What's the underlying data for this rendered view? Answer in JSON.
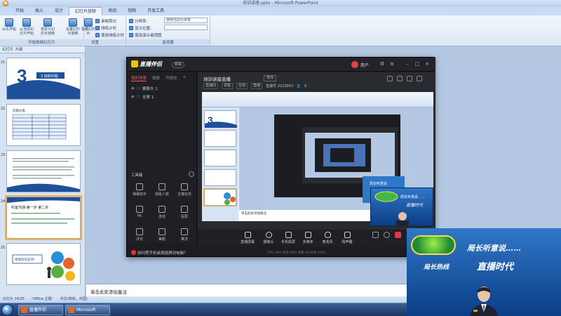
{
  "ppt": {
    "title": "培训讲座.pptx - Microsoft PowerPoint",
    "tabs": [
      "开始",
      "插入",
      "设计",
      "幻灯片放映",
      "审阅",
      "视图",
      "开发工具"
    ],
    "active_tab": "幻灯片放映",
    "ribbon": {
      "from_start": "从头开始",
      "from_current": "从当前幻灯片开始",
      "custom_show": "自定义幻灯片放映",
      "setup_show": "设置幻灯片放映",
      "hide_slide": "隐藏幻灯片",
      "record_narration": "录制旁白",
      "rehearse": "排练计时",
      "use_timings": "使用排练计时",
      "resolution_label": "分辨率:",
      "resolution_value": "使用当前分辨率",
      "show_on": "显示位置:",
      "presenter_view": "使用演示者视图",
      "group_start": "开始放映幻灯片",
      "group_setup": "设置",
      "group_monitors": "监视器"
    },
    "panel_tabs": "幻灯片 大纲",
    "slides": [
      {
        "num": "21",
        "text": "3 绩效问题"
      },
      {
        "num": "22",
        "text": "问题分类"
      },
      {
        "num": "23",
        "text": "一、二、三"
      },
      {
        "num": "24",
        "text": "科室沟通:第一步 第二步"
      },
      {
        "num": "25",
        "text": "感谢您的支持!"
      }
    ],
    "notes_placeholder": "单击此处添加备注",
    "status": {
      "slide_indicator": "幻灯片 24/25",
      "theme": "\"Office 主题\"",
      "language": "中文(简体，中国)"
    }
  },
  "live": {
    "logo": "直播伴侣",
    "badge": "新版",
    "user": "用户",
    "scene_tabs": [
      "我的场景",
      "场景",
      "可视化"
    ],
    "sources": [
      "摄像头 1",
      "全屏 1"
    ],
    "room_title": "培训讲座直播",
    "edit": "修改",
    "tags": [
      "直播间",
      "讲座",
      "在线",
      "直播"
    ],
    "room_id": "直播号 2023943",
    "viewers": "6",
    "tools_header": "工具箱",
    "tools": [
      "弹幕助手",
      "观看人数",
      "主播任务",
      "PK",
      "连线",
      "投屏",
      "评论",
      "美颜",
      "推流"
    ],
    "bottom": [
      "直播屏幕",
      "摄像头",
      "手机投屏",
      "多媒体",
      "麦克风",
      "扬声器"
    ],
    "notice": "如何把手机桌面投屏到电脑？",
    "status_text": "CPU 34%  内存 60%  帧率 30  码率 2500"
  },
  "cam_banner": {
    "line1": "局长听意说……",
    "line2": "局长热线",
    "line3": "直播时代"
  },
  "taskbar": {
    "items": [
      "直播伴侣",
      "Microsoft Powe..."
    ]
  }
}
